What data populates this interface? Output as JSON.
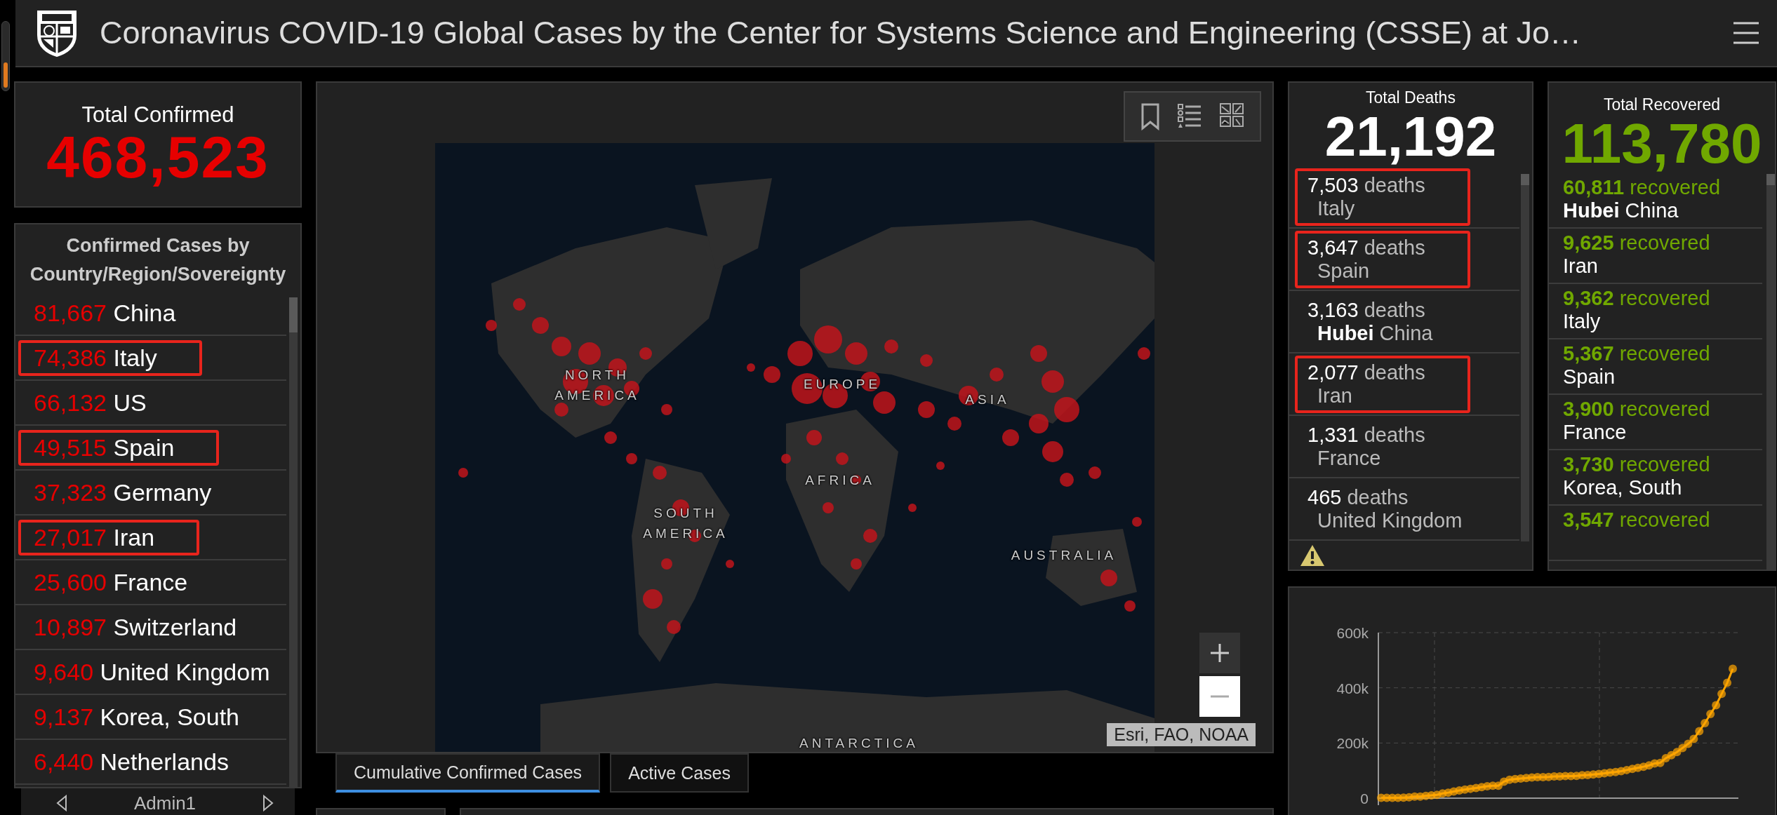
{
  "header": {
    "title": "Coronavirus COVID-19 Global Cases by the Center for Systems Science and Engineering (CSSE) at Jo…"
  },
  "total_confirmed": {
    "label": "Total Confirmed",
    "value": "468,523"
  },
  "confirmed_list": {
    "title": "Confirmed Cases by Country/Region/Sovereignty",
    "rows": [
      {
        "count": "81,667",
        "place": "China",
        "highlighted": false
      },
      {
        "count": "74,386",
        "place": "Italy",
        "highlighted": true
      },
      {
        "count": "66,132",
        "place": "US",
        "highlighted": false
      },
      {
        "count": "49,515",
        "place": "Spain",
        "highlighted": true
      },
      {
        "count": "37,323",
        "place": "Germany",
        "highlighted": false
      },
      {
        "count": "27,017",
        "place": "Iran",
        "highlighted": true
      },
      {
        "count": "25,600",
        "place": "France",
        "highlighted": false
      },
      {
        "count": "10,897",
        "place": "Switzerland",
        "highlighted": false
      },
      {
        "count": "9,640",
        "place": "United Kingdom",
        "highlighted": false
      },
      {
        "count": "9,137",
        "place": "Korea, South",
        "highlighted": false
      },
      {
        "count": "6,440",
        "place": "Netherlands",
        "highlighted": false
      }
    ]
  },
  "list_nav": {
    "label": "Admin1"
  },
  "map": {
    "labels": [
      "NORTH AMERICA",
      "EUROPE",
      "ASIA",
      "AFRICA",
      "SOUTH AMERICA",
      "AUSTRALIA",
      "ANTARCTICA"
    ],
    "attribution": "Esri, FAO, NOAA"
  },
  "map_tabs": [
    {
      "label": "Cumulative Confirmed Cases",
      "selected": true
    },
    {
      "label": "Active Cases",
      "selected": false
    }
  ],
  "total_deaths": {
    "label": "Total Deaths",
    "value": "21,192",
    "rows": [
      {
        "count": "7,503",
        "unit": "deaths",
        "place": "Italy",
        "highlighted": true
      },
      {
        "count": "3,647",
        "unit": "deaths",
        "place": "Spain",
        "highlighted": true
      },
      {
        "count": "3,163",
        "unit": "deaths",
        "place": "**Hubei** China",
        "highlighted": false
      },
      {
        "count": "2,077",
        "unit": "deaths",
        "place": "Iran",
        "highlighted": true
      },
      {
        "count": "1,331",
        "unit": "deaths",
        "place": "France",
        "highlighted": false
      },
      {
        "count": "465",
        "unit": "deaths",
        "place": "United Kingdom",
        "highlighted": false
      }
    ]
  },
  "total_recovered": {
    "label": "Total Recovered",
    "value": "113,780",
    "rows": [
      {
        "count": "60,811",
        "unit": "recovered",
        "place": "**Hubei** China"
      },
      {
        "count": "9,625",
        "unit": "recovered",
        "place": "Iran"
      },
      {
        "count": "9,362",
        "unit": "recovered",
        "place": "Italy"
      },
      {
        "count": "5,367",
        "unit": "recovered",
        "place": "Spain"
      },
      {
        "count": "3,900",
        "unit": "recovered",
        "place": "France"
      },
      {
        "count": "3,730",
        "unit": "recovered",
        "place": "Korea, South"
      },
      {
        "count": "3,547",
        "unit": "recovered"
      }
    ]
  },
  "chart": {
    "chart_data": {
      "type": "line",
      "grid": true,
      "ylim": [
        0,
        600000
      ],
      "yticks": [
        {
          "value": 0,
          "label": "0"
        },
        {
          "value": 200000,
          "label": "200k"
        },
        {
          "value": 400000,
          "label": "400k"
        },
        {
          "value": 600000,
          "label": "600k"
        }
      ],
      "series": [
        {
          "color": "#ffa500",
          "marker": "circle",
          "values": [
            1000,
            1000,
            1000,
            1000,
            2000,
            3000,
            6000,
            6000,
            8000,
            10000,
            12000,
            17000,
            20000,
            24000,
            28000,
            31000,
            34000,
            37000,
            40000,
            43000,
            45000,
            45000,
            60000,
            67000,
            69000,
            71000,
            73000,
            75000,
            76000,
            76000,
            77000,
            79000,
            79000,
            80000,
            80000,
            81000,
            83000,
            84000,
            86000,
            88000,
            90000,
            93000,
            95000,
            98000,
            102000,
            106000,
            110000,
            114000,
            119000,
            126000,
            128000,
            145000,
            156000,
            167000,
            182000,
            197000,
            215000,
            243000,
            272000,
            305000,
            337000,
            378000,
            418000,
            469000
          ]
        }
      ]
    }
  }
}
